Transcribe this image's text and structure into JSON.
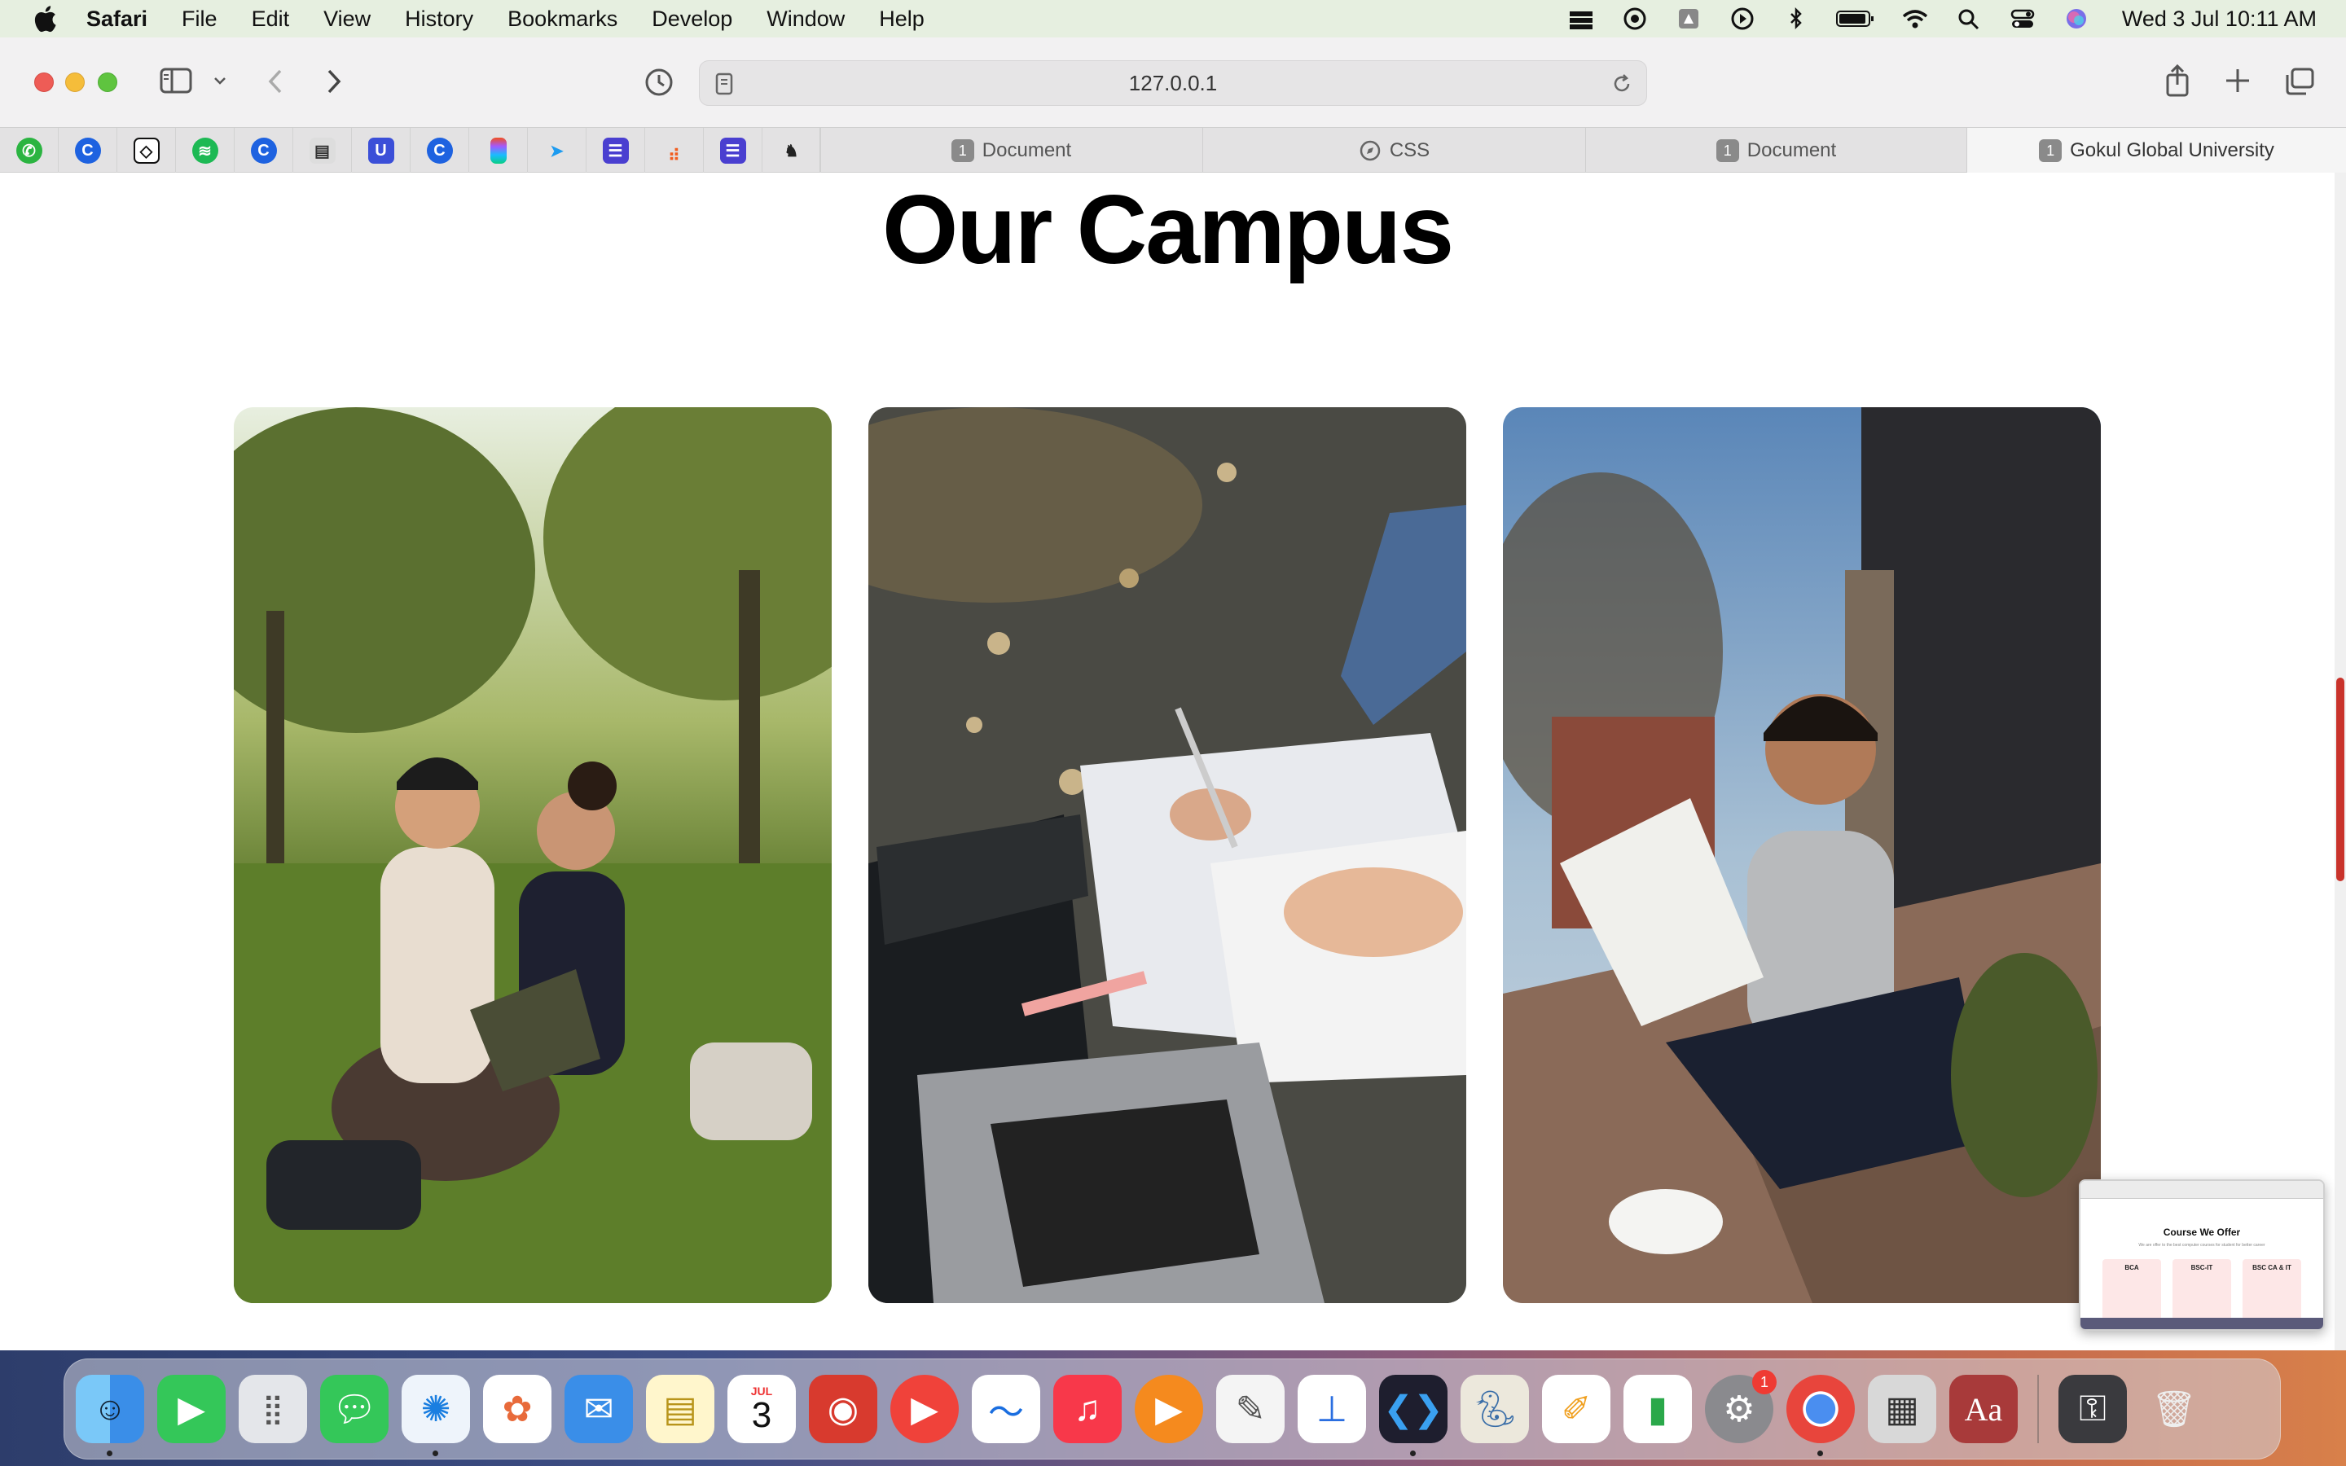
{
  "menubar": {
    "app_name": "Safari",
    "items": [
      "File",
      "Edit",
      "View",
      "History",
      "Bookmarks",
      "Develop",
      "Window",
      "Help"
    ],
    "clock": "Wed 3 Jul  10:11 AM",
    "status_icons": [
      "stack-icon",
      "timer-icon",
      "drive-icon",
      "play-circle-icon",
      "bluetooth-icon",
      "battery-icon",
      "wifi-icon",
      "search-icon",
      "control-center-icon",
      "siri-icon"
    ]
  },
  "browser": {
    "url": "127.0.0.1",
    "pinned_favicons": [
      "whatsapp-icon",
      "c-icon",
      "codepen-icon",
      "spotify-icon",
      "c-icon",
      "notes-icon",
      "u-icon",
      "c-icon",
      "figma-icon",
      "bird-icon",
      "list-icon",
      "chart-icon",
      "list-icon",
      "horse-icon"
    ],
    "tabs": [
      {
        "label": "Document",
        "badge": "1"
      },
      {
        "label": "CSS",
        "badge": ""
      },
      {
        "label": "Document",
        "badge": "1"
      },
      {
        "label": "Gokul Global University",
        "badge": "1"
      }
    ]
  },
  "page": {
    "title": "Our Campus",
    "photos": [
      "students-on-grass-photo",
      "notes-and-laptop-photo",
      "student-on-steps-photo"
    ]
  },
  "preview": {
    "title": "Course We Offer",
    "subtitle": "We are offer to the best computer courses for student for better career",
    "cards": [
      "BCA",
      "BSC-IT",
      "BSC CA & IT"
    ]
  },
  "dock": {
    "calendar_month": "JUL",
    "calendar_day": "3",
    "settings_badge": "1"
  },
  "colors": {
    "menubar_bg": "#e6efe0",
    "toolbar_bg": "#f2f1f2",
    "scroll_thumb": "#c9332b"
  }
}
